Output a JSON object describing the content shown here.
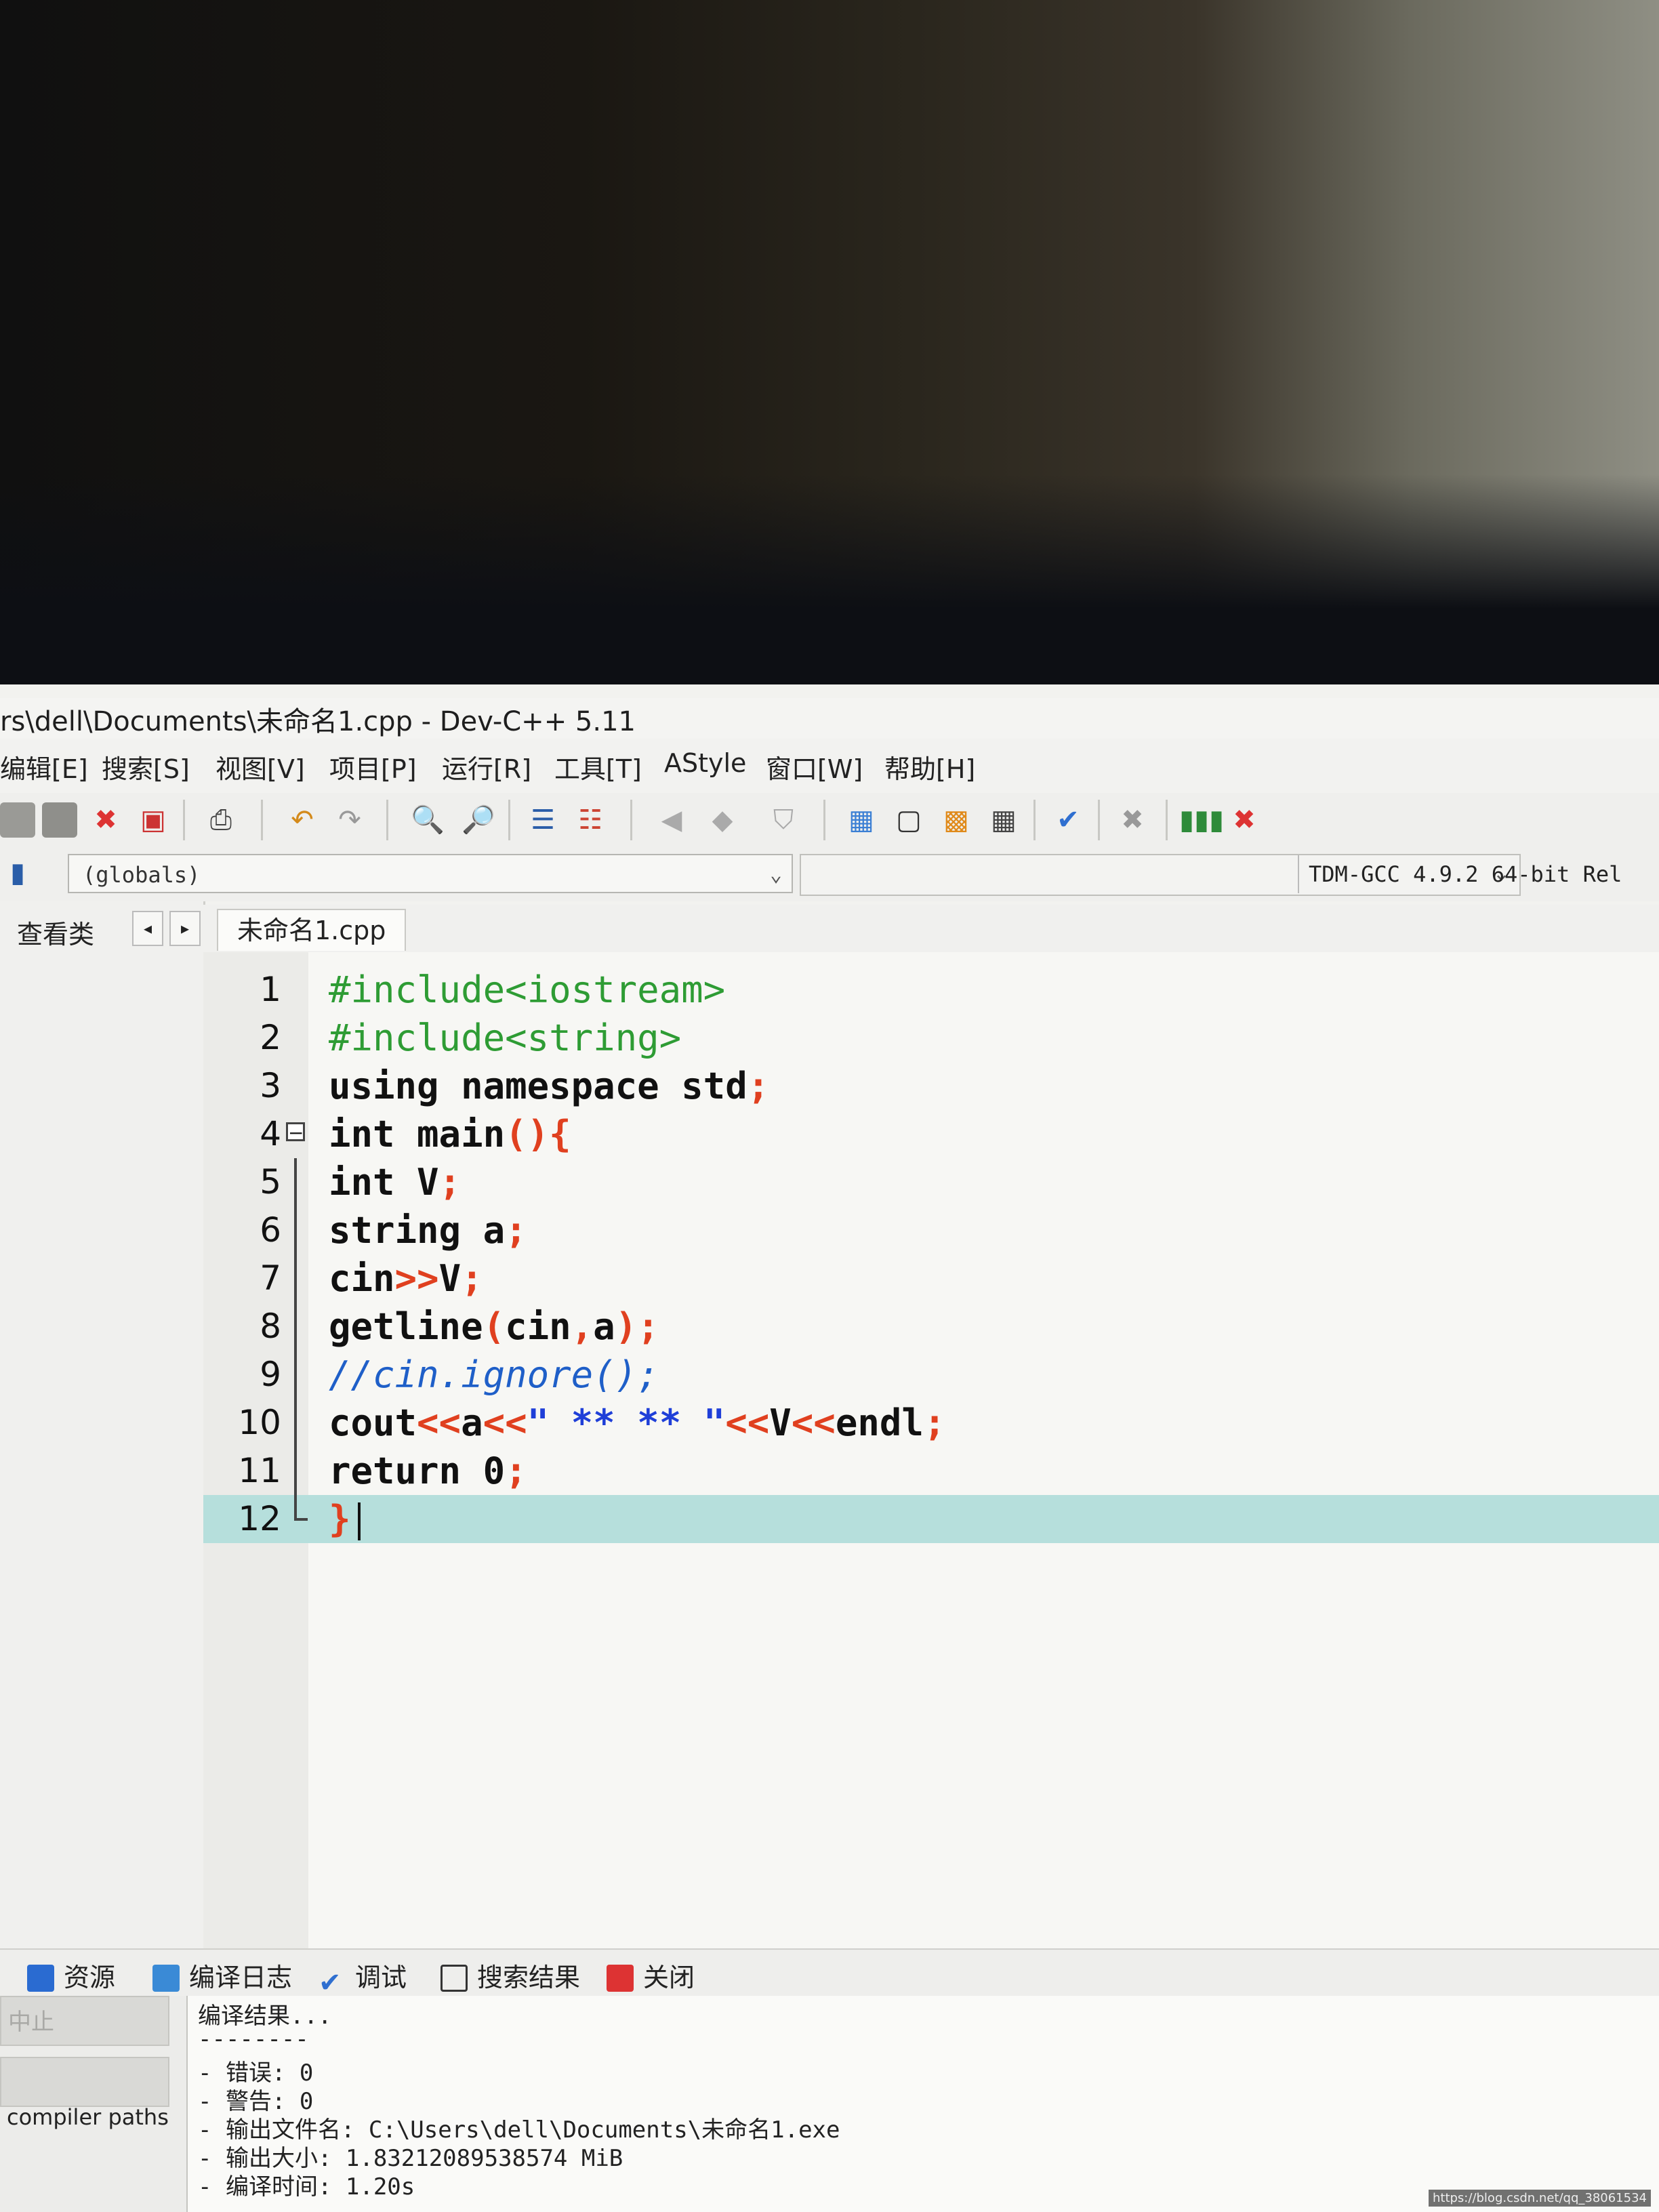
{
  "window": {
    "title": "rs\\dell\\Documents\\未命名1.cpp - Dev-C++ 5.11"
  },
  "menu": [
    {
      "label": "编辑[E]"
    },
    {
      "label": "搜索[S]"
    },
    {
      "label": "视图[V]"
    },
    {
      "label": "项目[P]"
    },
    {
      "label": "运行[R]"
    },
    {
      "label": "工具[T]"
    },
    {
      "label": "AStyle"
    },
    {
      "label": "窗口[W]"
    },
    {
      "label": "帮助[H]"
    }
  ],
  "toolbar": {
    "scope_select": "(globals)",
    "compiler_select": "TDM-GCC 4.9.2 64-bit Rel"
  },
  "left_panel": {
    "label": "查看类"
  },
  "editor": {
    "file_tab": "未命名1.cpp",
    "colors": {
      "preprocessor": "#2e9c34",
      "keyword": "#111111",
      "symbol": "#e0401f",
      "comment": "#1f5fc8",
      "string": "#1f3fd8",
      "number": "#111111",
      "current_line": "#b6dfdc"
    },
    "lines": [
      {
        "n": "1",
        "tokens": [
          {
            "t": "#include<iostream>",
            "c": "preprocessor"
          }
        ]
      },
      {
        "n": "2",
        "tokens": [
          {
            "t": "#include<string>",
            "c": "preprocessor"
          }
        ]
      },
      {
        "n": "3",
        "tokens": [
          {
            "t": "using namespace ",
            "c": "keyword"
          },
          {
            "t": "std",
            "c": "plain"
          },
          {
            "t": ";",
            "c": "symbol"
          }
        ]
      },
      {
        "n": "4",
        "tokens": [
          {
            "t": "int ",
            "c": "keyword"
          },
          {
            "t": "main",
            "c": "plain"
          },
          {
            "t": "(){",
            "c": "symbol"
          }
        ]
      },
      {
        "n": "5",
        "tokens": [
          {
            "t": "int ",
            "c": "keyword"
          },
          {
            "t": "V",
            "c": "plain"
          },
          {
            "t": ";",
            "c": "symbol"
          }
        ]
      },
      {
        "n": "6",
        "tokens": [
          {
            "t": "string a",
            "c": "plain"
          },
          {
            "t": ";",
            "c": "symbol"
          }
        ]
      },
      {
        "n": "7",
        "tokens": [
          {
            "t": "cin",
            "c": "plain"
          },
          {
            "t": ">>",
            "c": "symbol"
          },
          {
            "t": "V",
            "c": "plain"
          },
          {
            "t": ";",
            "c": "symbol"
          }
        ]
      },
      {
        "n": "8",
        "tokens": [
          {
            "t": "getline",
            "c": "plain"
          },
          {
            "t": "(",
            "c": "symbol"
          },
          {
            "t": "cin",
            "c": "plain"
          },
          {
            "t": ",",
            "c": "symbol"
          },
          {
            "t": "a",
            "c": "plain"
          },
          {
            "t": ");",
            "c": "symbol"
          }
        ]
      },
      {
        "n": "9",
        "tokens": [
          {
            "t": "//cin.ignore();",
            "c": "comment"
          }
        ]
      },
      {
        "n": "10",
        "tokens": [
          {
            "t": "cout",
            "c": "plain"
          },
          {
            "t": "<<",
            "c": "symbol"
          },
          {
            "t": "a",
            "c": "plain"
          },
          {
            "t": "<<",
            "c": "symbol"
          },
          {
            "t": "\" ** ** \"",
            "c": "string"
          },
          {
            "t": "<<",
            "c": "symbol"
          },
          {
            "t": "V",
            "c": "plain"
          },
          {
            "t": "<<",
            "c": "symbol"
          },
          {
            "t": "endl",
            "c": "plain"
          },
          {
            "t": ";",
            "c": "symbol"
          }
        ]
      },
      {
        "n": "11",
        "tokens": [
          {
            "t": "return ",
            "c": "keyword"
          },
          {
            "t": "0",
            "c": "number"
          },
          {
            "t": ";",
            "c": "symbol"
          }
        ]
      },
      {
        "n": "12",
        "tokens": [
          {
            "t": "}",
            "c": "symbol"
          }
        ]
      }
    ]
  },
  "bottom_tabs": [
    {
      "label": "资源",
      "icon": "resources-icon"
    },
    {
      "label": "编译日志",
      "icon": "chart-icon"
    },
    {
      "label": "调试",
      "icon": "check-icon"
    },
    {
      "label": "搜索结果",
      "icon": "search-results-icon"
    },
    {
      "label": "关闭",
      "icon": "close-icon"
    }
  ],
  "bottom_panel": {
    "stop_button": "中止",
    "compiler_paths": "compiler paths",
    "output_lines": [
      "编译结果...",
      "--------",
      "- 错误: 0",
      "- 警告: 0",
      "- 输出文件名: C:\\Users\\dell\\Documents\\未命名1.exe",
      "- 输出大小: 1.83212089538574 MiB",
      "- 编译时间: 1.20s"
    ]
  },
  "watermark": "https://blog.csdn.net/qq_38061534"
}
